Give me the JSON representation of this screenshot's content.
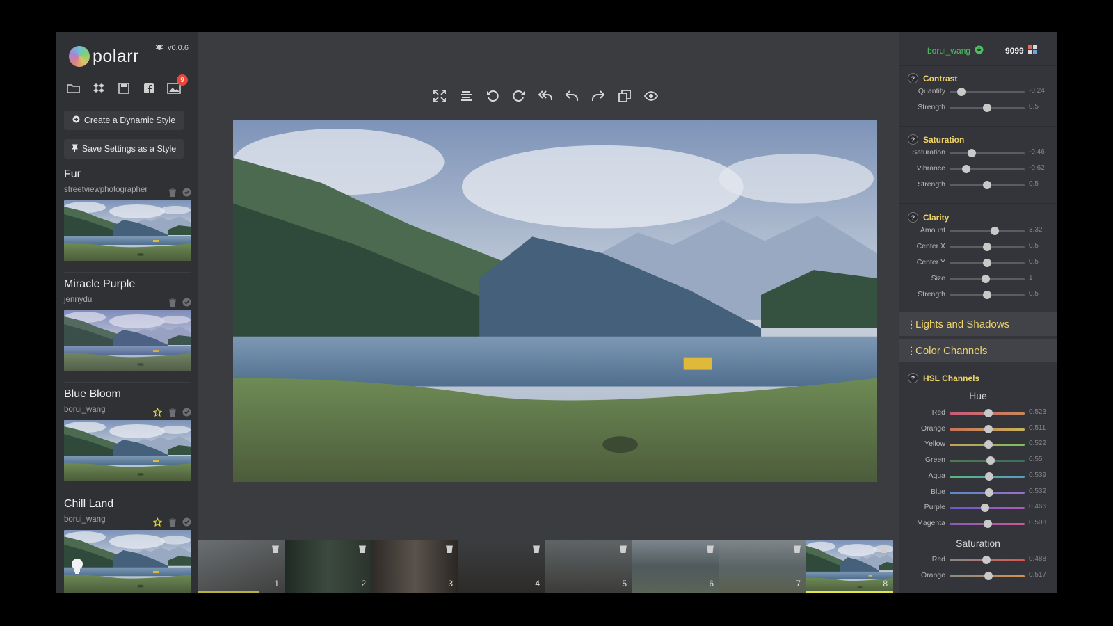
{
  "app": {
    "logo_text": "polarr",
    "version": "v0.0.6",
    "notification_count": "9"
  },
  "left_buttons": {
    "create_style": "Create a Dynamic Style",
    "save_style": "Save Settings as a Style"
  },
  "styles": [
    {
      "name": "Fur",
      "author": "streetviewphotographer",
      "starred": false
    },
    {
      "name": "Miracle Purple",
      "author": "jennydu",
      "starred": false
    },
    {
      "name": "Blue Bloom",
      "author": "borui_wang",
      "starred": true
    },
    {
      "name": "Chill Land",
      "author": "borui_wang",
      "starred": true
    }
  ],
  "account": {
    "username": "borui_wang",
    "credits": "9099"
  },
  "filmstrip": [
    "1",
    "2",
    "3",
    "4",
    "5",
    "6",
    "7",
    "8"
  ],
  "panels": {
    "contrast": {
      "title": "Contrast",
      "sliders": [
        {
          "label": "Quantity",
          "value": "-0.24",
          "pos": 0.16
        },
        {
          "label": "Strength",
          "value": "0.5",
          "pos": 0.5
        }
      ]
    },
    "saturation": {
      "title": "Saturation",
      "sliders": [
        {
          "label": "Saturation",
          "value": "-0.46",
          "pos": 0.3
        },
        {
          "label": "Vibrance",
          "value": "-0.62",
          "pos": 0.22
        },
        {
          "label": "Strength",
          "value": "0.5",
          "pos": 0.5
        }
      ]
    },
    "clarity": {
      "title": "Clarity",
      "sliders": [
        {
          "label": "Amount",
          "value": "3.32",
          "pos": 0.6
        },
        {
          "label": "Center X",
          "value": "0.5",
          "pos": 0.5
        },
        {
          "label": "Center Y",
          "value": "0.5",
          "pos": 0.5
        },
        {
          "label": "Size",
          "value": "1",
          "pos": 0.48
        },
        {
          "label": "Strength",
          "value": "0.5",
          "pos": 0.5
        }
      ]
    },
    "lights_and_shadows": "Lights and Shadows",
    "color_channels": "Color Channels",
    "hsl": {
      "title": "HSL Channels",
      "hue_heading": "Hue",
      "saturation_heading": "Saturation",
      "hue": [
        {
          "label": "Red",
          "value": "0.523",
          "pos": 0.52
        },
        {
          "label": "Orange",
          "value": "0.511",
          "pos": 0.52
        },
        {
          "label": "Yellow",
          "value": "0.522",
          "pos": 0.52
        },
        {
          "label": "Green",
          "value": "0.55",
          "pos": 0.55
        },
        {
          "label": "Aqua",
          "value": "0.539",
          "pos": 0.53
        },
        {
          "label": "Blue",
          "value": "0.532",
          "pos": 0.53
        },
        {
          "label": "Purple",
          "value": "0.466",
          "pos": 0.47
        },
        {
          "label": "Magenta",
          "value": "0.508",
          "pos": 0.51
        }
      ],
      "saturation": [
        {
          "label": "Red",
          "value": "0.488",
          "pos": 0.49
        },
        {
          "label": "Orange",
          "value": "0.517",
          "pos": 0.52
        }
      ]
    }
  },
  "colors": {
    "accent": "#efd36a",
    "online": "#4cc25f",
    "film_highlight": "#e5e24a"
  }
}
